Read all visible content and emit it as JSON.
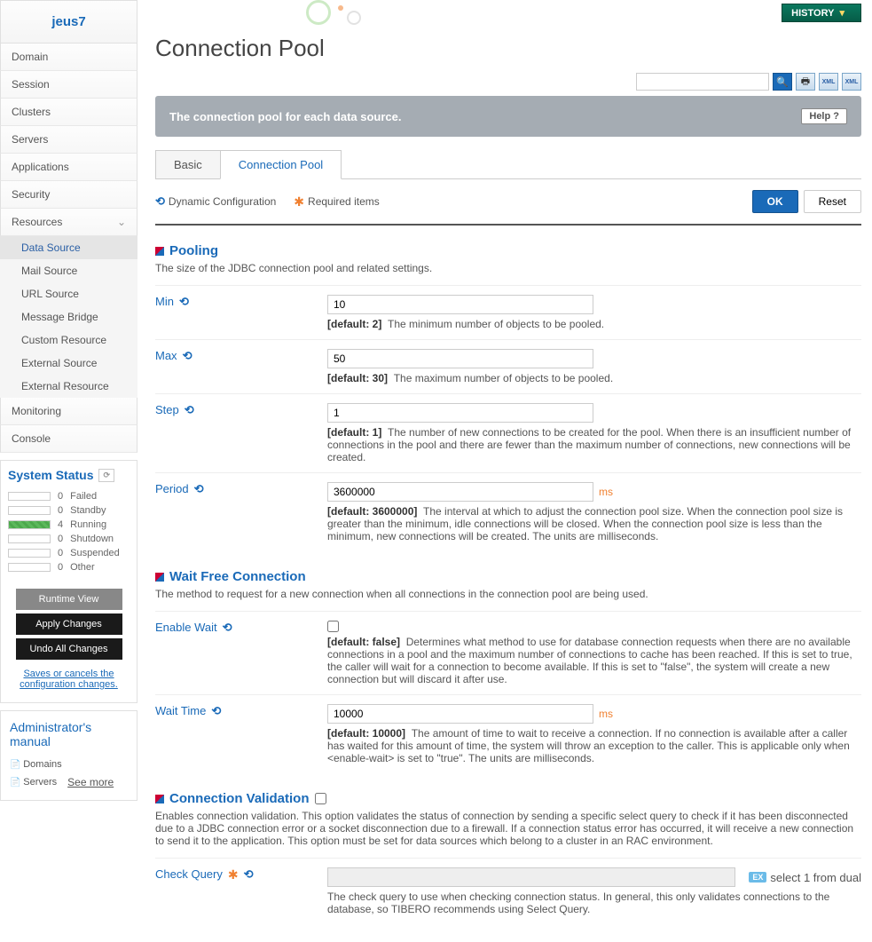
{
  "brand": "jeus7",
  "nav": {
    "items": [
      "Domain",
      "Session",
      "Clusters",
      "Servers",
      "Applications",
      "Security",
      "Resources",
      "Monitoring",
      "Console"
    ],
    "sub": [
      "Data Source",
      "Mail Source",
      "URL Source",
      "Message Bridge",
      "Custom Resource",
      "External Source",
      "External Resource"
    ]
  },
  "status": {
    "title": "System Status",
    "lines": [
      {
        "count": "0",
        "label": "Failed"
      },
      {
        "count": "0",
        "label": "Standby"
      },
      {
        "count": "4",
        "label": "Running"
      },
      {
        "count": "0",
        "label": "Shutdown"
      },
      {
        "count": "0",
        "label": "Suspended"
      },
      {
        "count": "0",
        "label": "Other"
      }
    ]
  },
  "actions": {
    "runtime": "Runtime View",
    "apply": "Apply Changes",
    "undo": "Undo All Changes",
    "note": "Saves or cancels the configuration changes."
  },
  "admin": {
    "title": "Administrator's manual",
    "links": [
      "Domains",
      "Servers"
    ],
    "more": "See more"
  },
  "topbar": {
    "history": "HISTORY"
  },
  "page": {
    "title": "Connection Pool",
    "desc": "The connection pool for each data source.",
    "help": "Help ?"
  },
  "tabs": [
    "Basic",
    "Connection Pool"
  ],
  "legend": {
    "dynamic": "Dynamic Configuration",
    "required": "Required items"
  },
  "buttons": {
    "ok": "OK",
    "reset": "Reset"
  },
  "pooling": {
    "title": "Pooling",
    "desc": "The size of the JDBC connection pool and related settings.",
    "min": {
      "label": "Min",
      "value": "10",
      "default": "[default: 2]",
      "help": "The minimum number of objects to be pooled."
    },
    "max": {
      "label": "Max",
      "value": "50",
      "default": "[default: 30]",
      "help": "The maximum number of objects to be pooled."
    },
    "step": {
      "label": "Step",
      "value": "1",
      "default": "[default: 1]",
      "help": "The number of new connections to be created for the pool. When there is an insufficient number of connections in the pool and there are fewer than the maximum number of connections, new connections will be created."
    },
    "period": {
      "label": "Period",
      "value": "3600000",
      "unit": "ms",
      "default": "[default: 3600000]",
      "help": "The interval at which to adjust the connection pool size. When the connection pool size is greater than the minimum, idle connections will be closed. When the connection pool size is less than the minimum, new connections will be created. The units are milliseconds."
    }
  },
  "wait": {
    "title": "Wait Free Connection",
    "desc": "The method to request for a new connection when all connections in the connection pool are being used.",
    "enable": {
      "label": "Enable Wait",
      "default": "[default: false]",
      "help": "Determines what method to use for database connection requests when there are no available connections in a pool and the maximum number of connections to cache has been reached. If this is set to true, the caller will wait for a connection to become available. If this is set to \"false\", the system will create a new connection but will discard it after use."
    },
    "time": {
      "label": "Wait Time",
      "value": "10000",
      "unit": "ms",
      "default": "[default: 10000]",
      "help": "The amount of time to wait to receive a connection. If no connection is available after a caller has waited for this amount of time, the system will throw an exception to the caller. This is applicable only when <enable-wait> is set to \"true\". The units are milliseconds."
    }
  },
  "validation": {
    "title": "Connection Validation",
    "desc": "Enables connection validation. This option validates the status of connection by sending a specific select query to check if it has been disconnected due to a JDBC connection error or a socket disconnection due to a firewall. If a connection status error has occurred, it will receive a new connection to send it to the application. This option must be set for data sources which belong to a cluster in an RAC environment.",
    "query": {
      "label": "Check Query",
      "ex_badge": "EX",
      "ex": "select 1 from dual",
      "help": "The check query to use when checking connection status. In general, this only validates connections to the database, so TIBERO recommends using Select Query."
    }
  }
}
